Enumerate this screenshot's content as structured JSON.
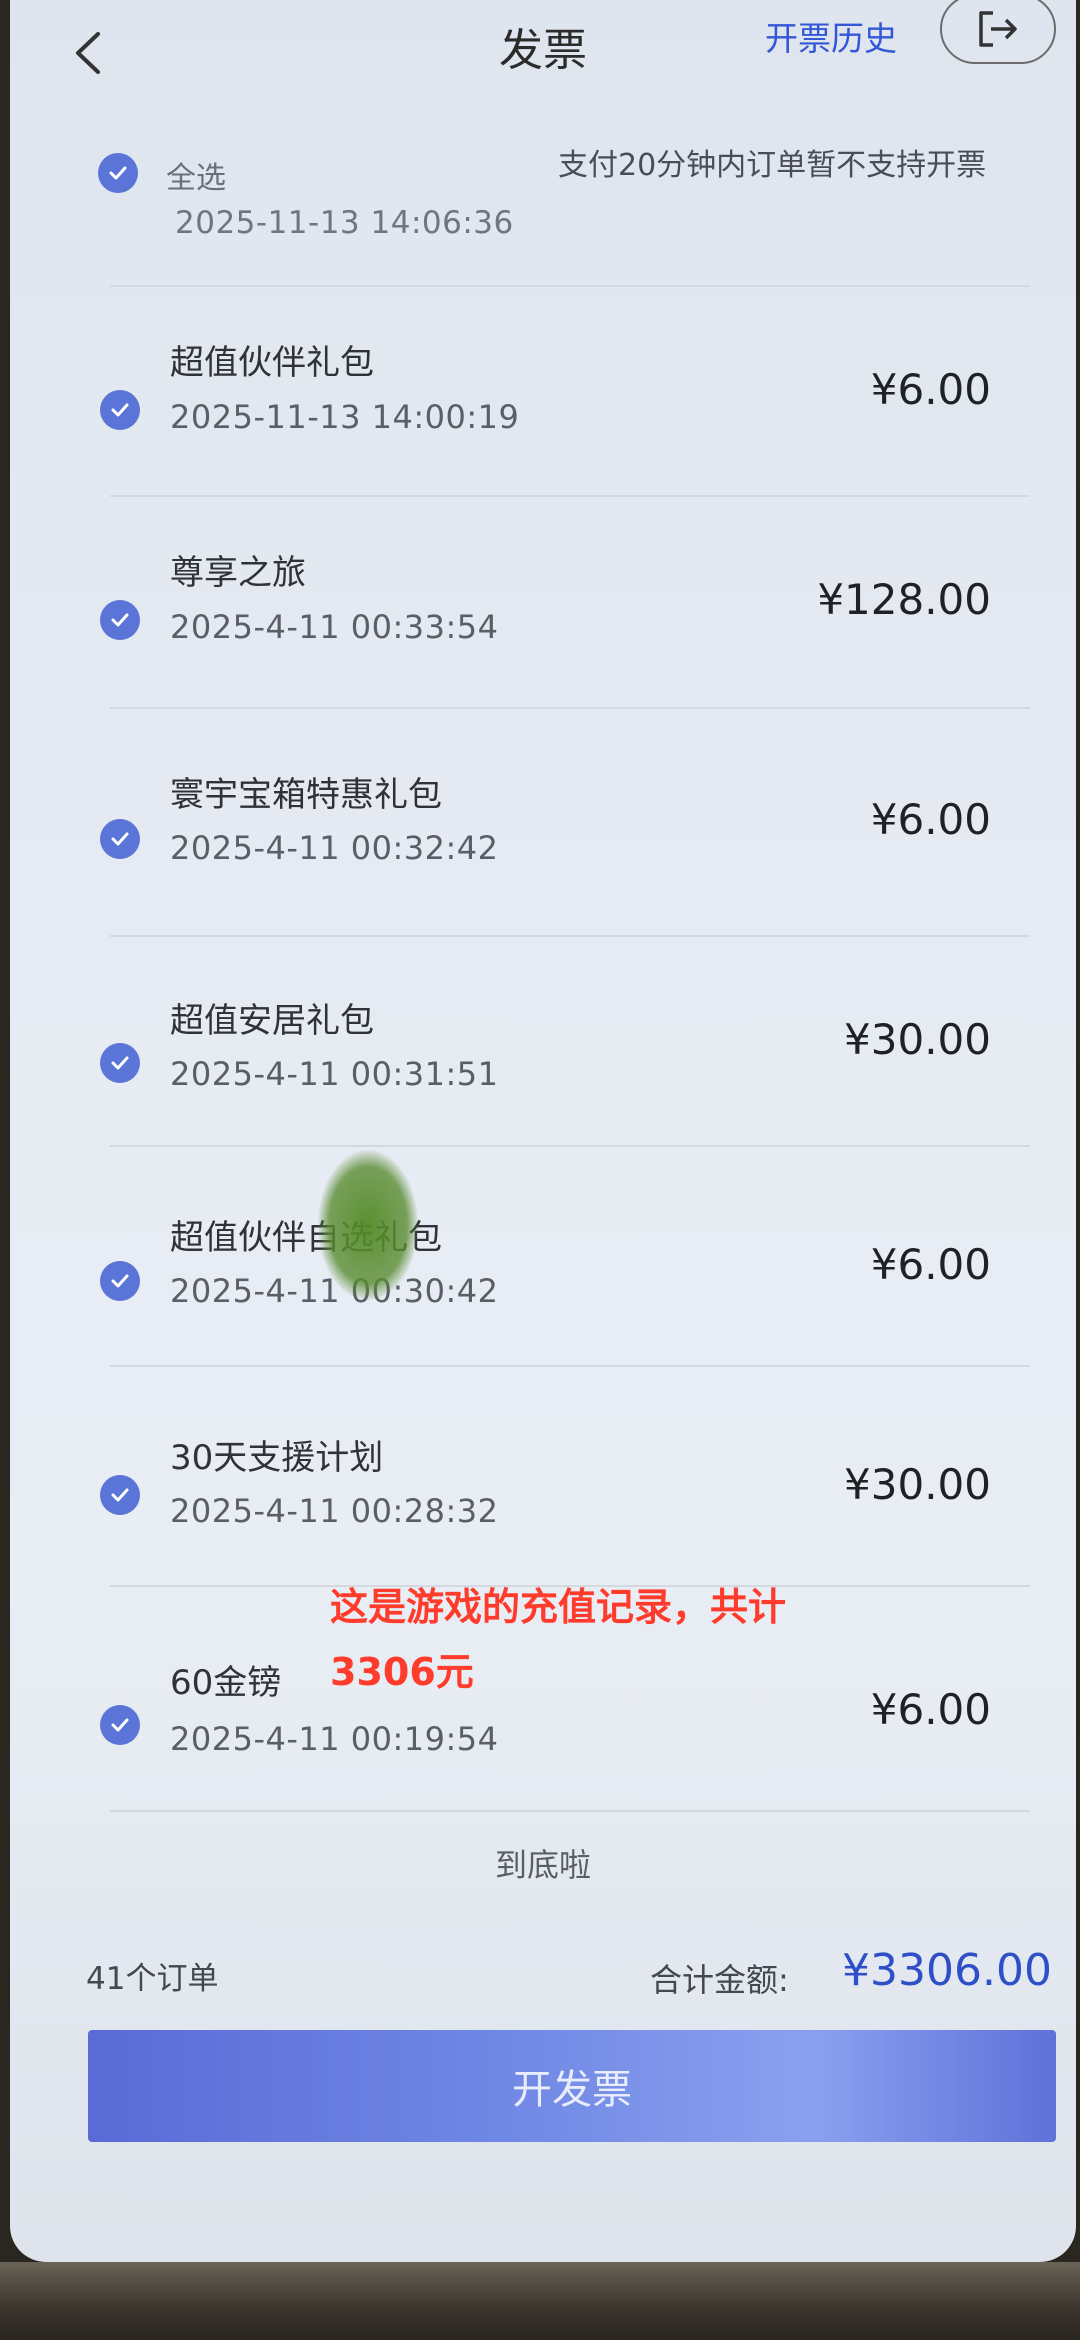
{
  "header": {
    "title": "发票",
    "history_link": "开票历史"
  },
  "select_all": {
    "label": "全选",
    "hint": "支付20分钟内订单暂不支持开票"
  },
  "partial_order": {
    "time": "2025-11-13 14:06:36"
  },
  "orders": [
    {
      "name": "超值伙伴礼包",
      "time": "2025-11-13 14:00:19",
      "price": "¥6.00"
    },
    {
      "name": "尊享之旅",
      "time": "2025-4-11 00:33:54",
      "price": "¥128.00"
    },
    {
      "name": "寰宇宝箱特惠礼包",
      "time": "2025-4-11 00:32:42",
      "price": "¥6.00"
    },
    {
      "name": "超值安居礼包",
      "time": "2025-4-11 00:31:51",
      "price": "¥30.00"
    },
    {
      "name": "超值伙伴自选礼包",
      "time": "2025-4-11 00:30:42",
      "price": "¥6.00"
    },
    {
      "name": "30天支援计划",
      "time": "2025-4-11 00:28:32",
      "price": "¥30.00"
    },
    {
      "name": "60金镑",
      "time": "2025-4-11 00:19:54",
      "price": "¥6.00"
    }
  ],
  "list_end": "到底啦",
  "footer": {
    "order_count": "41个订单",
    "total_label": "合计金额:",
    "total_value": "¥3306.00",
    "submit_label": "开发票"
  },
  "annotation": {
    "line1": "这是游戏的充值记录，共计",
    "line2": "3306元"
  },
  "colors": {
    "accent": "#3357d6",
    "check": "#5b74d8",
    "annotation": "#ff3b2b"
  }
}
